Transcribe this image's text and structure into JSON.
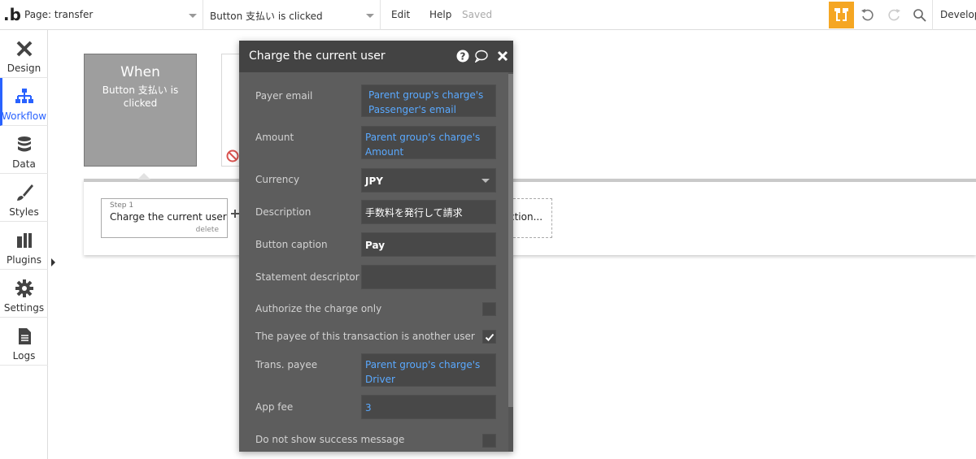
{
  "topbar": {
    "logo": ".b",
    "page_label": "Page: transfer",
    "event_label": "Button 支払い is clicked",
    "menu_edit": "Edit",
    "menu_help": "Help",
    "saved_status": "Saved",
    "develop_label": "Develop",
    "accent_color": "#f5a623"
  },
  "sidebar": {
    "items": [
      {
        "label": "Design",
        "icon": "design-tools-icon"
      },
      {
        "label": "Workflow",
        "icon": "workflow-tree-icon"
      },
      {
        "label": "Data",
        "icon": "database-icon"
      },
      {
        "label": "Styles",
        "icon": "brush-icon"
      },
      {
        "label": "Plugins",
        "icon": "plug-icon"
      },
      {
        "label": "Settings",
        "icon": "gear-icon"
      },
      {
        "label": "Logs",
        "icon": "document-icon"
      }
    ],
    "active_color": "#2962ff"
  },
  "workflow": {
    "when_title": "When",
    "when_event": "Button 支払い is clicked",
    "step_number": "Step 1",
    "step_title": "Charge the current user",
    "step_delete": "delete",
    "add_action_label": "ction..."
  },
  "panel": {
    "title": "Charge the current user",
    "fields": {
      "payer_email": {
        "label": "Payer email",
        "value": "Parent group's charge's Passenger's email"
      },
      "amount": {
        "label": "Amount",
        "value": "Parent group's charge's Amount"
      },
      "currency": {
        "label": "Currency",
        "value": "JPY"
      },
      "description": {
        "label": "Description",
        "value": "手数料を発行して請求"
      },
      "button_caption": {
        "label": "Button caption",
        "value": "Pay"
      },
      "statement_descriptor": {
        "label": "Statement descriptor",
        "value": ""
      },
      "authorize_only": {
        "label": "Authorize the charge only",
        "checked": false
      },
      "payee_other": {
        "label": "The payee of this transaction is another user",
        "checked": true
      },
      "trans_payee": {
        "label": "Trans. payee",
        "value": "Parent group's charge's Driver"
      },
      "app_fee": {
        "label": "App fee",
        "value": "3"
      },
      "no_success_msg": {
        "label": "Do not show success message",
        "checked": false
      }
    },
    "dynamic_color": "#5aa9ff"
  }
}
